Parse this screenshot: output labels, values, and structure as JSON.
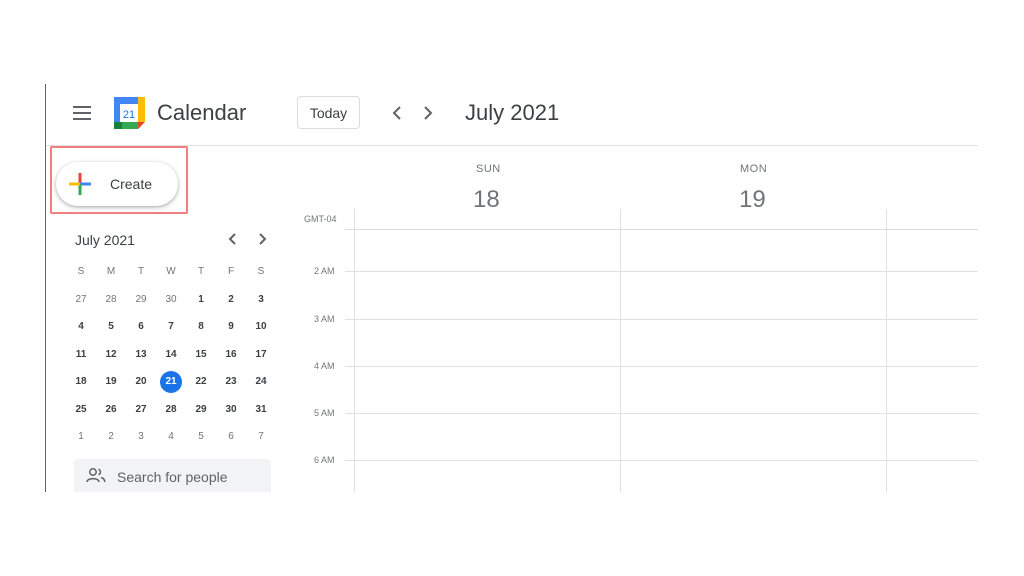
{
  "header": {
    "app_title": "Calendar",
    "logo_day": "21",
    "today_label": "Today",
    "current_period": "July 2021"
  },
  "create_button": {
    "label": "Create"
  },
  "mini_calendar": {
    "month_label": "July 2021",
    "weekdays": [
      "S",
      "M",
      "T",
      "W",
      "T",
      "F",
      "S"
    ],
    "weeks": [
      [
        "27",
        "28",
        "29",
        "30",
        "1",
        "2",
        "3"
      ],
      [
        "4",
        "5",
        "6",
        "7",
        "8",
        "9",
        "10"
      ],
      [
        "11",
        "12",
        "13",
        "14",
        "15",
        "16",
        "17"
      ],
      [
        "18",
        "19",
        "20",
        "21",
        "22",
        "23",
        "24"
      ],
      [
        "25",
        "26",
        "27",
        "28",
        "29",
        "30",
        "31"
      ],
      [
        "1",
        "2",
        "3",
        "4",
        "5",
        "6",
        "7"
      ]
    ],
    "selected_day": "21"
  },
  "search_people": {
    "placeholder": "Search for people"
  },
  "grid": {
    "days": [
      {
        "name": "SUN",
        "number": "18"
      },
      {
        "name": "MON",
        "number": "19"
      }
    ],
    "timezone": "GMT-04",
    "time_labels": [
      "2 AM",
      "3 AM",
      "4 AM",
      "5 AM",
      "6 AM"
    ]
  },
  "colors": {
    "accent": "#1a73e8",
    "highlight_border": "#f08080",
    "plus_blue": "#4285f4",
    "plus_red": "#ea4335",
    "plus_yellow": "#fbbc04",
    "plus_green": "#34a853"
  },
  "icons": {
    "menu": "menu-icon",
    "logo": "calendar-logo-icon",
    "prev": "chevron-left-icon",
    "next": "chevron-right-icon",
    "create": "plus-icon",
    "people": "people-icon"
  }
}
